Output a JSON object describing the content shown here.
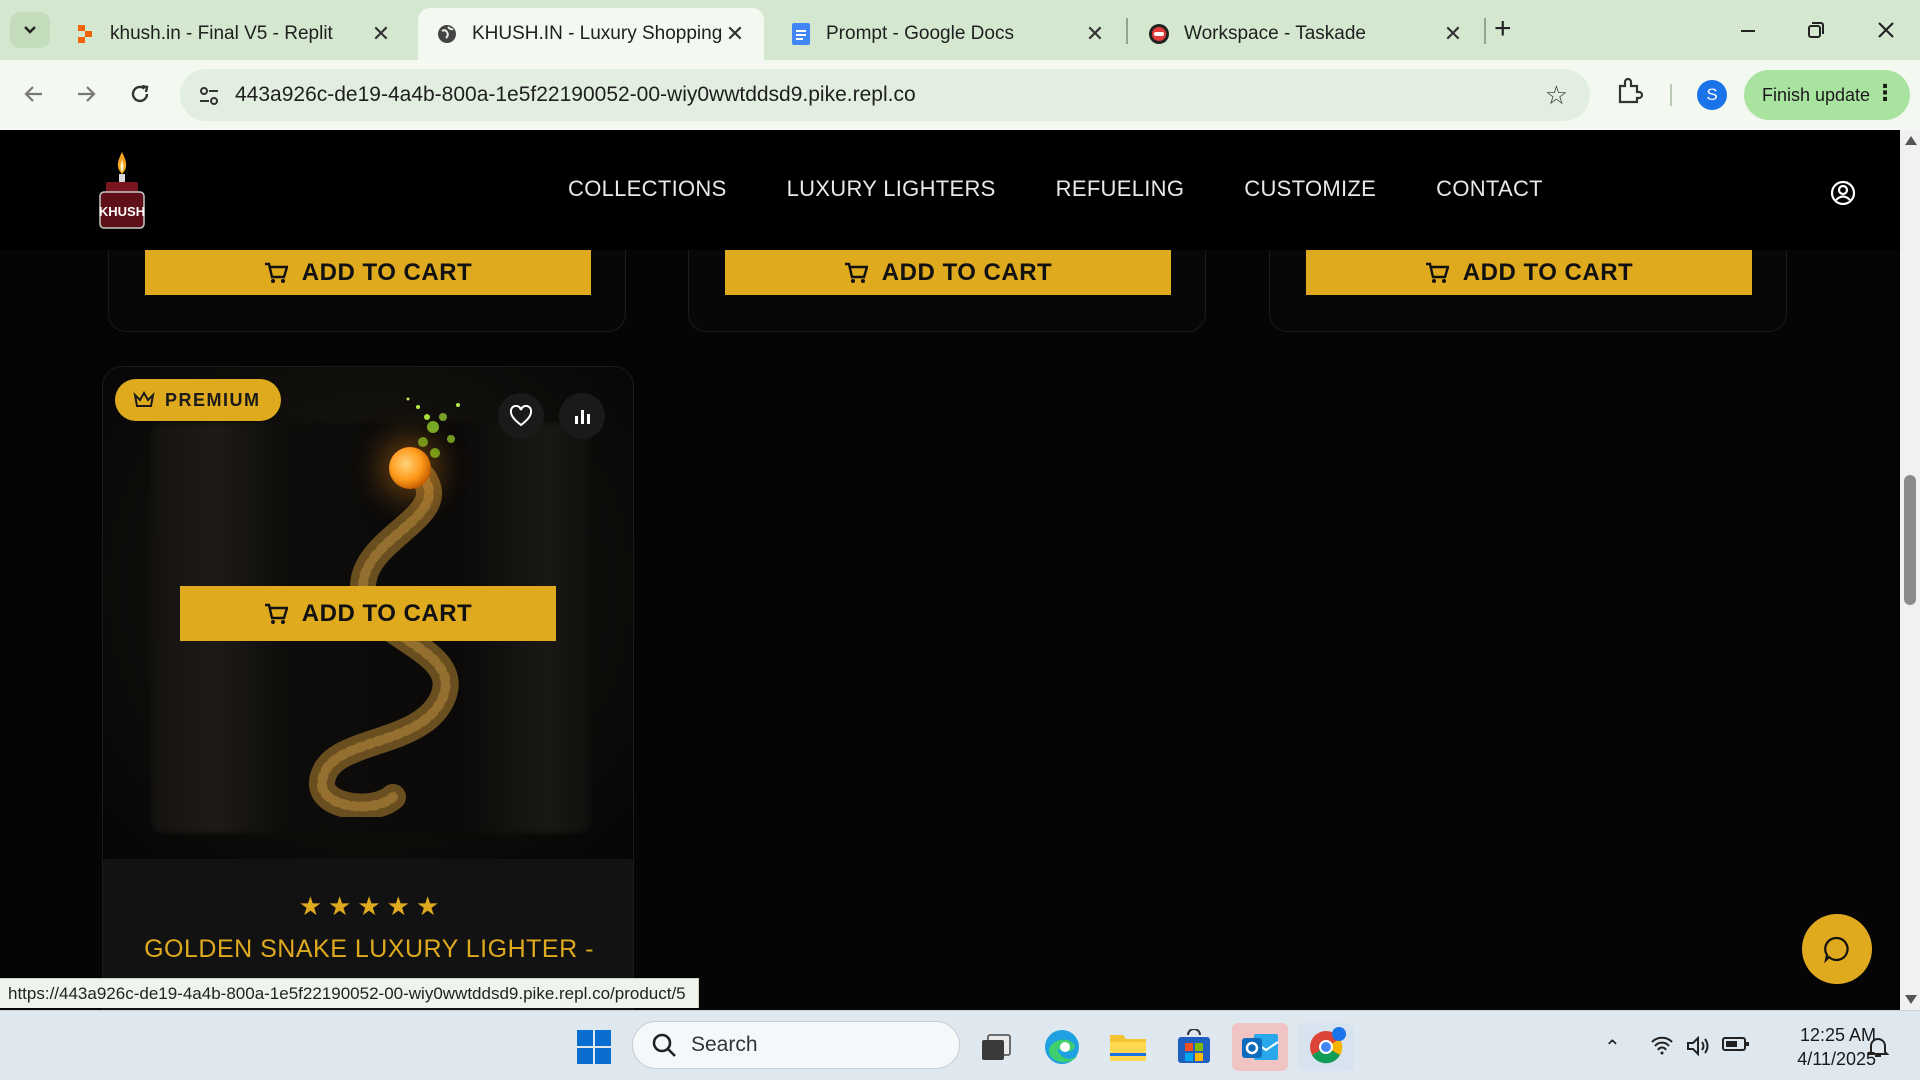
{
  "browser": {
    "tabs": [
      {
        "title": "khush.in - Final V5 - Replit",
        "favicon": "replit-icon",
        "active": false
      },
      {
        "title": "KHUSH.IN - Luxury Shopping Ex",
        "favicon": "globe-icon",
        "active": true
      },
      {
        "title": "Prompt - Google Docs",
        "favicon": "docs-icon",
        "active": false
      },
      {
        "title": "Workspace - Taskade",
        "favicon": "taskade-icon",
        "active": false
      }
    ],
    "url": "443a926c-de19-4a4b-800a-1e5f22190052-00-wiy0wwtddsd9.pike.repl.co",
    "profile_initial": "S",
    "finish_update_label": "Finish update",
    "status_url": "https://443a926c-de19-4a4b-800a-1e5f22190052-00-wiy0wwtddsd9.pike.repl.co/product/5"
  },
  "site": {
    "logo_text": "KHUSH",
    "nav": [
      "COLLECTIONS",
      "LUXURY LIGHTERS",
      "REFUELING",
      "CUSTOMIZE",
      "CONTACT"
    ],
    "add_to_cart_label": "ADD TO CART",
    "product": {
      "badge": "PREMIUM",
      "rating": 5,
      "title": "GOLDEN SNAKE LUXURY LIGHTER -",
      "cart_label": "ADD TO CART"
    },
    "colors": {
      "accent": "#E0AA1F",
      "background": "#050505"
    }
  },
  "taskbar": {
    "search_placeholder": "Search",
    "time": "12:25 AM",
    "date": "4/11/2025"
  }
}
